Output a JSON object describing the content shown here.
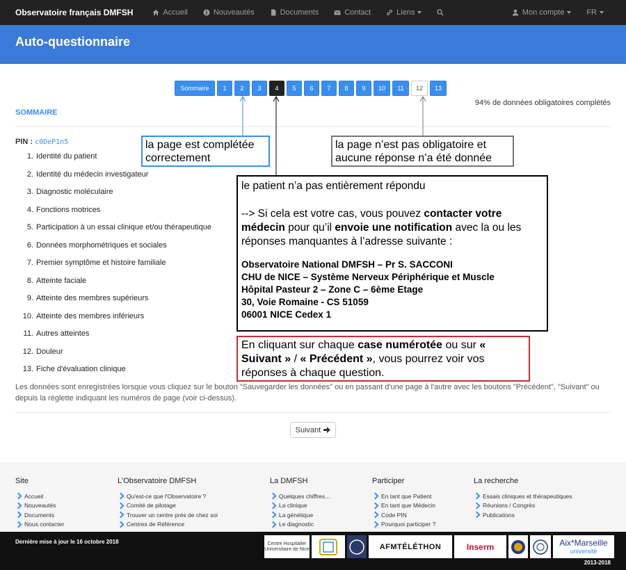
{
  "navbar": {
    "brand": "Observatoire français DMFSH",
    "items": [
      {
        "label": "Accueil",
        "icon": "home-icon"
      },
      {
        "label": "Nouveautés",
        "icon": "info-icon"
      },
      {
        "label": "Documents",
        "icon": "document-icon"
      },
      {
        "label": "Contact",
        "icon": "envelope-icon"
      },
      {
        "label": "Liens",
        "icon": "link-icon"
      }
    ],
    "account": "Mon compte",
    "lang": "FR"
  },
  "header": {
    "title": "Auto-questionnaire"
  },
  "pager": {
    "sommaire": "Sommaire",
    "pages": [
      "1",
      "2",
      "3",
      "4",
      "5",
      "6",
      "7",
      "8",
      "9",
      "10",
      "11",
      "12",
      "13"
    ],
    "current": "4",
    "blank": "12"
  },
  "progress": {
    "text": "94% de données obligatoires complétés"
  },
  "sommaire": {
    "title": "SOMMAIRE"
  },
  "pin": {
    "label": "PIN :",
    "code": "c0DeP1n5"
  },
  "toc": [
    {
      "num": "1.",
      "title": "Identité du patient"
    },
    {
      "num": "2.",
      "title": "Identité du médecin investigateur"
    },
    {
      "num": "3.",
      "title": "Diagnostic moléculaire"
    },
    {
      "num": "4.",
      "title": "Fonctions motrices"
    },
    {
      "num": "5.",
      "title": "Participation à un essai clinique et/ou thérapeutique"
    },
    {
      "num": "6.",
      "title": "Données morphométriques et sociales"
    },
    {
      "num": "7.",
      "title": "Premier symptôme et histoire familiale"
    },
    {
      "num": "8.",
      "title": "Atteinte faciale"
    },
    {
      "num": "9.",
      "title": "Atteinte des membres supérieurs"
    },
    {
      "num": "10.",
      "title": "Atteinte des membres inférieurs"
    },
    {
      "num": "11.",
      "title": "Autres atteintes"
    },
    {
      "num": "12.",
      "title": "Douleur"
    },
    {
      "num": "13.",
      "title": "Fiche d'évaluation clinique"
    }
  ],
  "note": "Les données sont enregistrées lorsque vous cliquez sur le bouton \"Sauvegarder les données\" ou en passant d'une page à l'autre avec les boutons \"Précédent\", \"Suivant\" ou depuis la réglette indiquant les numéros de page (voir ci-dessus).",
  "next_button": "Suivant",
  "callouts": {
    "blue": "la page est complétée correctement",
    "gray": "la page n’est pas obligatoire et aucune réponse n’a été donnée",
    "black": {
      "line1": "le patient n’a pas entièrement répondu",
      "p_a": "--> Si cela est votre cas, vous pouvez ",
      "p_b": "contacter votre médecin",
      "p_c": " pour qu’il ",
      "p_d": "envoie une notification",
      "p_e": " avec la ou les réponses manquantes à l’adresse suivante :",
      "addr": [
        "Observatoire National DMFSH – Pr S. SACCONI",
        "CHU de NICE – Système Nerveux Périphérique et Muscle",
        "Hôpital Pasteur 2 – Zone C – 6ème Etage",
        "30, Voie Romaine - CS 51059",
        "06001 NICE Cedex 1"
      ]
    },
    "red": {
      "a": "En cliquant sur chaque ",
      "b": "case numérotée",
      "c": " ou sur ",
      "d": "« Suivant »",
      "e": " / ",
      "f": "« Précédent »",
      "g": ", vous pourrez voir vos réponses à chaque question."
    }
  },
  "footer": {
    "columns": [
      {
        "title": "Site",
        "links": [
          "Accueil",
          "Nouveautés",
          "Documents",
          "Nous contacter"
        ]
      },
      {
        "title": "L'Observatoire DMFSH",
        "links": [
          "Qu'est-ce que l'Observatoire ?",
          "Comité de pilotage",
          "Trouver un centre près de chez soi",
          "Centres de Référence"
        ]
      },
      {
        "title": "La DMFSH",
        "links": [
          "Quelques chiffres...",
          "La clinique",
          "La génétique",
          "Le diagnostic"
        ]
      },
      {
        "title": "Participer",
        "links": [
          "En tant que Patient",
          "En tant que Médecin",
          "Code PIN",
          "Pourquoi participer ?"
        ]
      },
      {
        "title": "La recherche",
        "links": [
          "Essais cliniques et thérapeutiques",
          "Réunions / Congrès",
          "Publications"
        ]
      }
    ],
    "updated": "Dernière mise à jour le 16 octobre 2018",
    "copyright": "2013-2018",
    "logos": {
      "chu": "Centre Hospitalier Universitaire de Nice",
      "afm": "AFMTÉLÉTHON",
      "inserm": "Inserm",
      "aix1": "Aix*Marseille",
      "aix2": "université"
    }
  }
}
